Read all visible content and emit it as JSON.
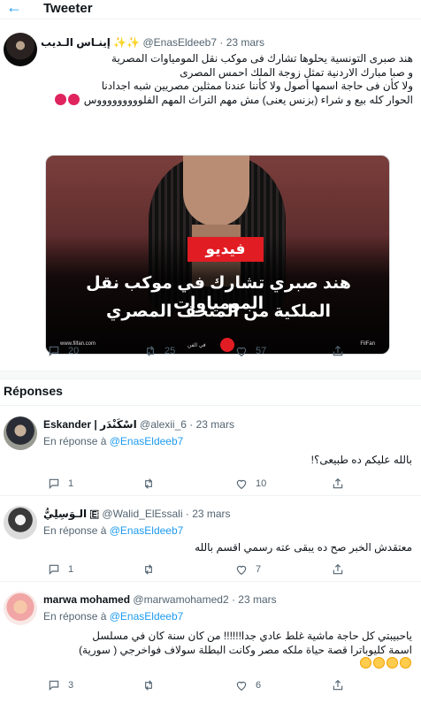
{
  "header": {
    "back_icon": "arrow-left-icon",
    "title": "Tweeter"
  },
  "main_tweet": {
    "name": "إينـاس الـديب ✨✨",
    "handle": "@EnasEldeeb7",
    "date": "· 23 mars",
    "text_lines": [
      "هند صبرى التونسية يحلوها تشارك فى موكب نقل المومياوات المصرية",
      "و صبا مبارك الاردنية تمثل زوجة الملك احمس المصرى",
      "ولا كأن فى حاجة اسمها أصول ولا كأننا عندنا ممثلين مصريين شبه اجدادنا",
      "الحوار كله بيع و شراء (بزنس يعنى) مش مهم التراث المهم الفلوووووووووس"
    ],
    "media": {
      "label": "فيديو",
      "headline_1": "هند صبري تشارك في موكب نقل المومياوات",
      "headline_2": "الملكية من المتحف المصري",
      "site": "www.filfan.com",
      "brand": "في الفن",
      "social": "FilFan"
    },
    "counts": {
      "reply": "20",
      "retweet": "25",
      "like": "57"
    }
  },
  "replies_section": {
    "title": "Réponses"
  },
  "replies": [
    {
      "name": "Eskander | اسْكَنْدَر",
      "handle": "@alexii_6",
      "date": "· 23 mars",
      "in_reply_label": "En réponse à",
      "in_reply_handle": "@EnasEldeeb7",
      "text": "بالله عليكم ده طبيعى؟!",
      "counts": {
        "reply": "1",
        "retweet": "",
        "like": "10"
      }
    },
    {
      "name": "الـوَسِلِيُّ 🇪",
      "handle": "@Walid_ElEssali",
      "date": "· 23 mars",
      "in_reply_label": "En réponse à",
      "in_reply_handle": "@EnasEldeeb7",
      "text": "معتقدش الخبر صح ده يبقى عته رسمي اقسم بالله",
      "counts": {
        "reply": "1",
        "retweet": "",
        "like": "7"
      }
    },
    {
      "name": "marwa mohamed",
      "handle": "@marwamohamed2",
      "date": "· 23 mars",
      "in_reply_label": "En réponse à",
      "in_reply_handle": "@EnasEldeeb7",
      "text_lines": [
        "ياحبيبتي كل حاجة ماشية غلط عادي جدا!!!!!! من كان سنة كان في مسلسل",
        "اسمة كليوباترا قصة حياة ملكه مصر وكانت البطلة سولاف فواخرجي ( سورية)"
      ],
      "counts": {
        "reply": "3",
        "retweet": "",
        "like": "6"
      }
    }
  ],
  "colors": {
    "accent": "#1d9bf0",
    "muted": "#536471",
    "red": "#e21c23"
  },
  "icons": [
    "reply-icon",
    "retweet-icon",
    "like-icon",
    "share-icon",
    "laughing-emoji-icon",
    "angry-emoji-icon"
  ]
}
